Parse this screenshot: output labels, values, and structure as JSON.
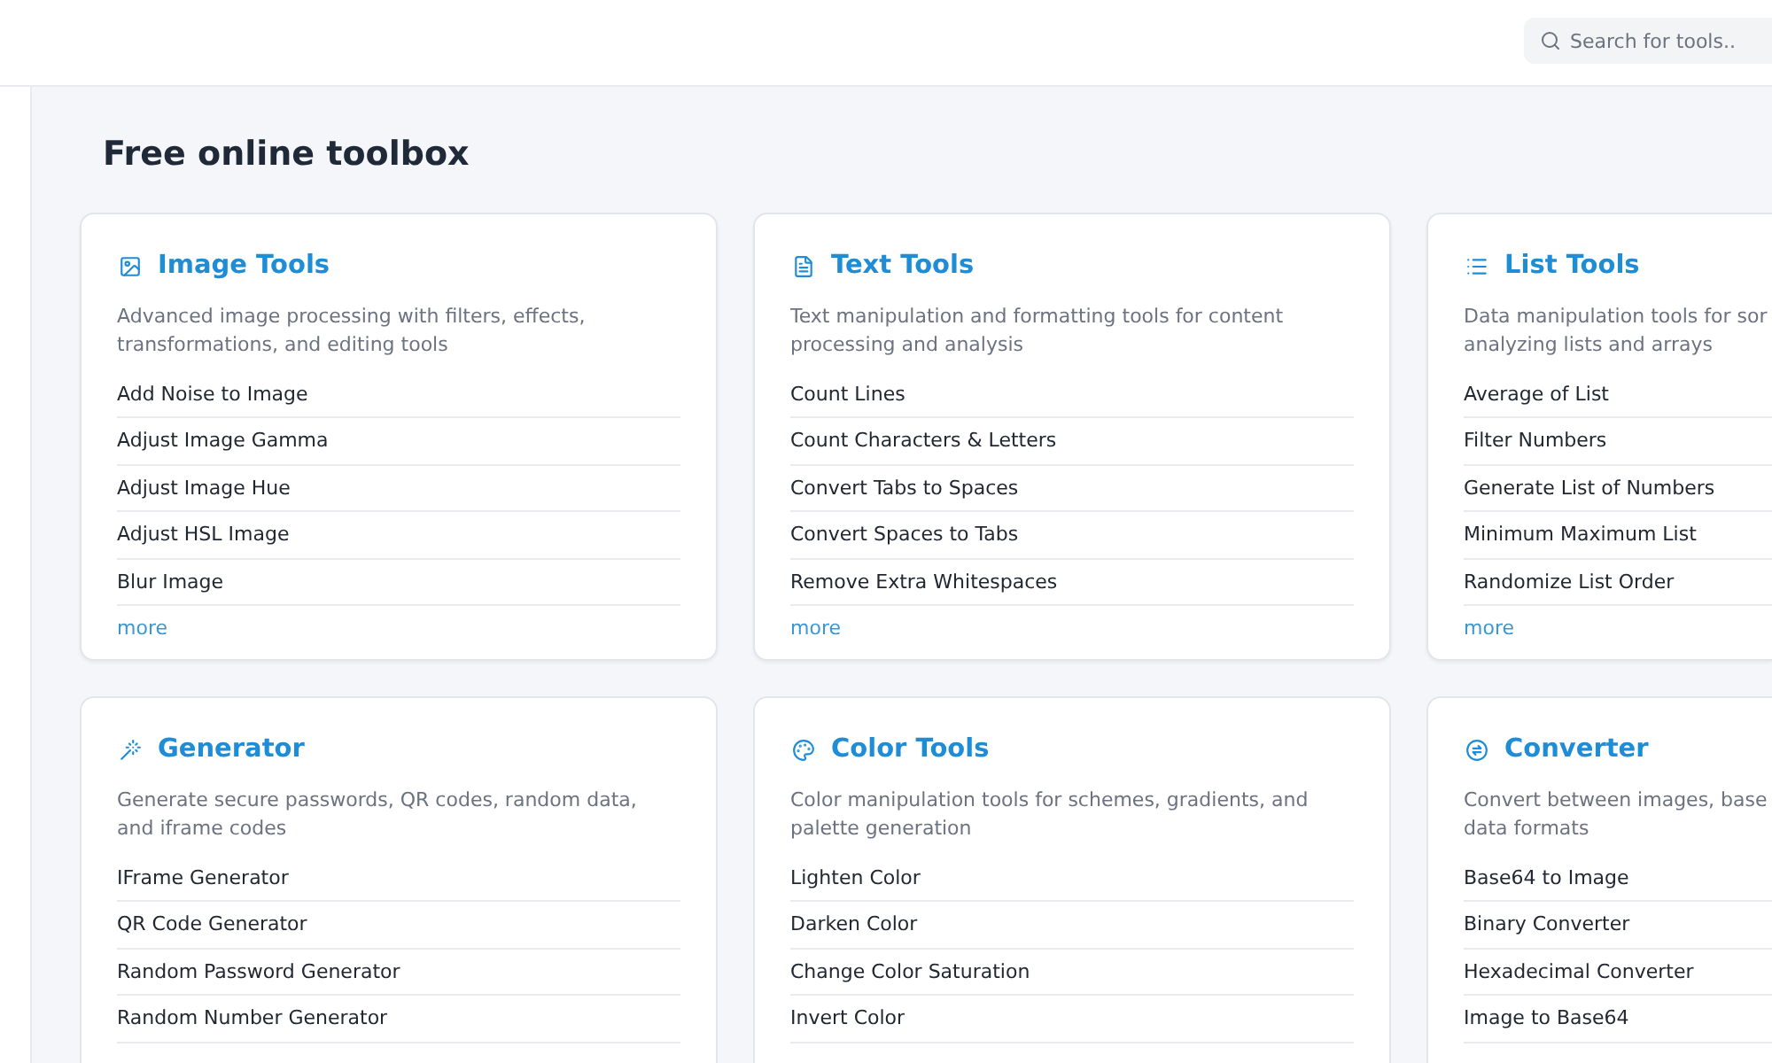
{
  "header": {
    "search": {
      "placeholder": "Search for tools.."
    }
  },
  "page_title": "Free online toolbox",
  "categories": [
    {
      "kind": "image",
      "title": "Image Tools",
      "description_lines": [
        "Advanced image processing with filters, effects,",
        "transformations, and editing tools"
      ],
      "tools": [
        "Add Noise to Image",
        "Adjust Image Gamma",
        "Adjust Image Hue",
        "Adjust HSL Image",
        "Blur Image"
      ],
      "more": "more"
    },
    {
      "kind": "text",
      "title": "Text Tools",
      "description_lines": [
        "Text manipulation and formatting tools for content",
        "processing and analysis"
      ],
      "tools": [
        "Count Lines",
        "Count Characters & Letters",
        "Convert Tabs to Spaces",
        "Convert Spaces to Tabs",
        "Remove Extra Whitespaces"
      ],
      "more": "more"
    },
    {
      "kind": "list",
      "title": "List Tools",
      "description_lines": [
        "Data manipulation tools for sor",
        "analyzing lists and arrays"
      ],
      "tools": [
        "Average of List",
        "Filter Numbers",
        "Generate List of Numbers",
        "Minimum Maximum List",
        "Randomize List Order"
      ],
      "more": "more"
    },
    {
      "kind": "generator",
      "title": "Generator",
      "description_lines": [
        "Generate secure passwords, QR codes, random data,",
        "and iframe codes"
      ],
      "tools": [
        "IFrame Generator",
        "QR Code Generator",
        "Random Password Generator",
        "Random Number Generator"
      ]
    },
    {
      "kind": "color",
      "title": "Color Tools",
      "description_lines": [
        "Color manipulation tools for schemes, gradients, and",
        "palette generation"
      ],
      "tools": [
        "Lighten Color",
        "Darken Color",
        "Change Color Saturation",
        "Invert Color"
      ]
    },
    {
      "kind": "converter",
      "title": "Converter",
      "description_lines": [
        "Convert between images, base",
        "data formats"
      ],
      "tools": [
        "Base64 to Image",
        "Binary Converter",
        "Hexadecimal Converter",
        "Image to Base64"
      ]
    }
  ]
}
